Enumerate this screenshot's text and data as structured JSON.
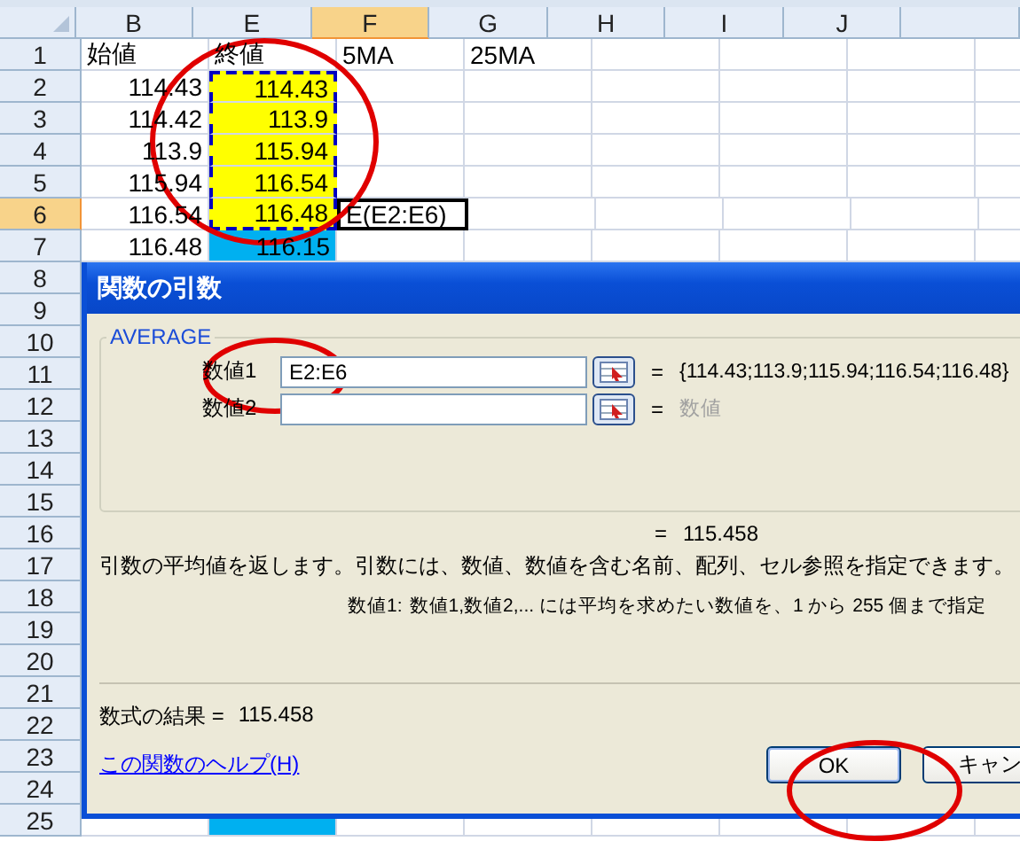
{
  "sheet": {
    "columns": [
      {
        "label": "B",
        "selected": false
      },
      {
        "label": "E",
        "selected": false
      },
      {
        "label": "F",
        "selected": true
      },
      {
        "label": "G",
        "selected": false
      },
      {
        "label": "H",
        "selected": false
      },
      {
        "label": "I",
        "selected": false
      },
      {
        "label": "J",
        "selected": false
      }
    ],
    "rows": [
      {
        "label": "1",
        "selected": false,
        "cells": [
          {
            "kind": "label",
            "text": "始値"
          },
          {
            "kind": "label",
            "text": "終値"
          },
          {
            "kind": "label",
            "text": "5MA"
          },
          {
            "kind": "label",
            "text": "25MA"
          }
        ]
      },
      {
        "label": "2",
        "selected": false,
        "cells": [
          {
            "kind": "number",
            "text": "114.43"
          },
          {
            "kind": "number",
            "text": "114.43",
            "color": "#ffff00",
            "marquee": true
          }
        ]
      },
      {
        "label": "3",
        "selected": false,
        "cells": [
          {
            "kind": "number",
            "text": "114.42"
          },
          {
            "kind": "number",
            "text": "113.9",
            "color": "#ffff00",
            "marquee": true
          }
        ]
      },
      {
        "label": "4",
        "selected": false,
        "cells": [
          {
            "kind": "number",
            "text": "113.9"
          },
          {
            "kind": "number",
            "text": "115.94",
            "color": "#ffff00",
            "marquee": true
          }
        ]
      },
      {
        "label": "5",
        "selected": false,
        "cells": [
          {
            "kind": "number",
            "text": "115.94"
          },
          {
            "kind": "number",
            "text": "116.54",
            "color": "#ffff00",
            "marquee": true
          }
        ]
      },
      {
        "label": "6",
        "selected": true,
        "cells": [
          {
            "kind": "number",
            "text": "116.54"
          },
          {
            "kind": "number",
            "text": "116.48",
            "color": "#ffff00",
            "marquee": true
          },
          {
            "kind": "label",
            "text": "E(E2:E6)",
            "active": true
          }
        ]
      },
      {
        "label": "7",
        "selected": false,
        "cells": [
          {
            "kind": "number",
            "text": "116.48"
          },
          {
            "kind": "number",
            "text": "116.15",
            "color": "#00b0f0"
          }
        ]
      },
      {
        "label": "8",
        "selected": false,
        "cells": []
      },
      {
        "label": "9",
        "selected": false,
        "cells": []
      },
      {
        "label": "10",
        "selected": false,
        "cells": []
      },
      {
        "label": "11",
        "selected": false,
        "cells": []
      },
      {
        "label": "12",
        "selected": false,
        "cells": []
      },
      {
        "label": "13",
        "selected": false,
        "cells": []
      },
      {
        "label": "14",
        "selected": false,
        "cells": []
      },
      {
        "label": "15",
        "selected": false,
        "cells": []
      },
      {
        "label": "16",
        "selected": false,
        "cells": []
      },
      {
        "label": "17",
        "selected": false,
        "cells": []
      },
      {
        "label": "18",
        "selected": false,
        "cells": []
      },
      {
        "label": "19",
        "selected": false,
        "cells": []
      },
      {
        "label": "20",
        "selected": false,
        "cells": []
      },
      {
        "label": "21",
        "selected": false,
        "cells": []
      },
      {
        "label": "22",
        "selected": false,
        "cells": []
      },
      {
        "label": "23",
        "selected": false,
        "cells": []
      },
      {
        "label": "24",
        "selected": false,
        "cells": []
      },
      {
        "label": "25",
        "selected": false,
        "cells": [
          {
            "kind": "number"
          },
          {
            "kind": "number",
            "color": "#00b0f0"
          }
        ]
      }
    ]
  },
  "dialog": {
    "title": "関数の引数",
    "function_name": "AVERAGE",
    "arguments": [
      {
        "label": "数値1",
        "value": "E2:E6",
        "equals": "=",
        "result": "{114.43;113.9;115.94;116.54;116.48}",
        "result_is_hint": false
      },
      {
        "label": "数値2",
        "equals": "=",
        "result": "数値",
        "result_is_hint": true
      }
    ],
    "total": {
      "equals": "=",
      "value": "115.458"
    },
    "description": "引数の平均値を返します。引数には、数値、数値を含む名前、配列、セル参照を指定できます。",
    "argument_help": {
      "label": "数値1:",
      "text": "数値1,数値2,... には平均を求めたい数値を、1 から 255 個まで指定"
    },
    "formula_result": {
      "label": "数式の結果 =",
      "value": "115.458"
    },
    "help_link": "この関数のヘルプ(H)",
    "buttons": [
      {
        "label": "OK",
        "default": true
      },
      {
        "label": "キャン",
        "default": false
      }
    ]
  }
}
